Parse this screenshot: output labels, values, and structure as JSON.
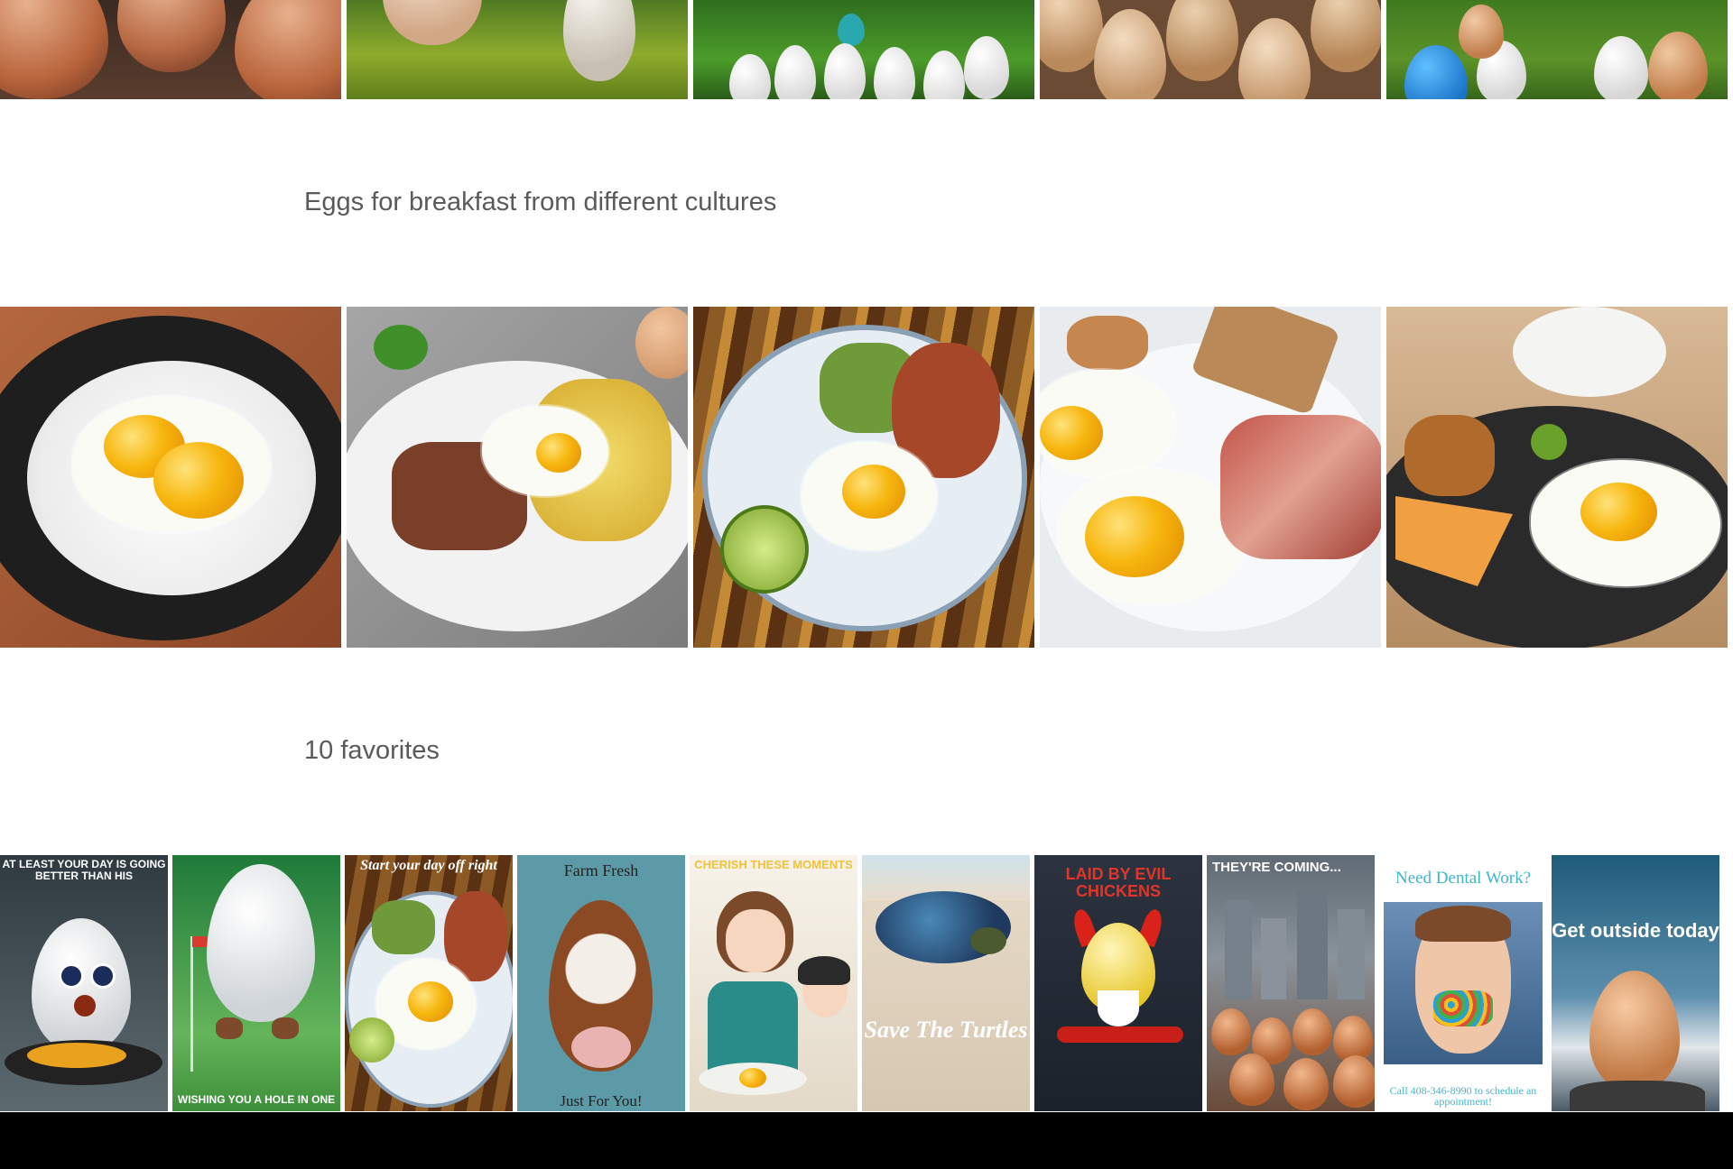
{
  "sections": {
    "breakfast_title": "Eggs for breakfast from different cultures",
    "favorites_title": "10 favorites"
  },
  "posters": {
    "p1_text": "At least your day is going better than his",
    "p2_text": "Wishing you a hole in one",
    "p3_text": "Start your day off right",
    "p4_top": "Farm Fresh",
    "p4_bottom": "Just For You!",
    "p5_text": "CHERISH THESE MOMENTS",
    "p6_text": "Save The Turtles",
    "p7_text": "LAID BY EVIL CHICKENS",
    "p8_text": "THEY'RE COMING...",
    "p9_top": "Need Dental Work?",
    "p9_bottom": "Call 408-346-8990 to schedule an appointment!",
    "p10_text": "Get outside today"
  },
  "colors": {
    "heading": "#5a5a5a",
    "bottom_bar": "#000000"
  }
}
